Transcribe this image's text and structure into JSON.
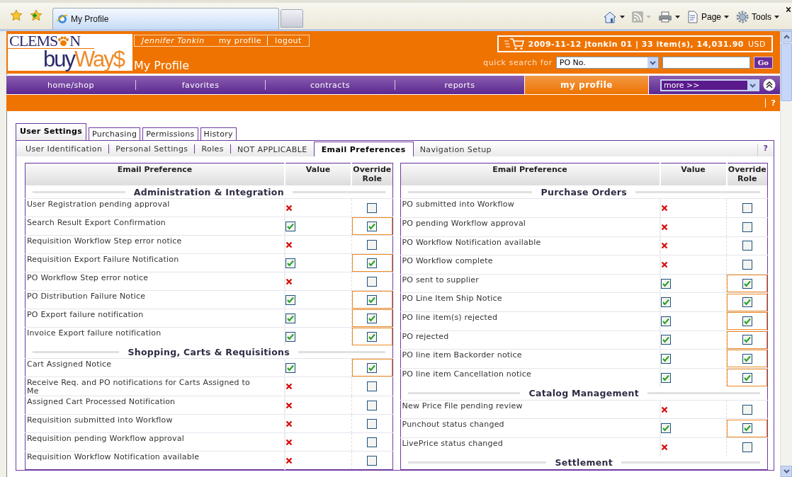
{
  "browser": {
    "tab_title": "My Profile",
    "toolbar": [
      {
        "kind": "home"
      },
      {
        "kind": "feed"
      },
      {
        "kind": "print"
      },
      {
        "kind": "page",
        "label": "Page"
      },
      {
        "kind": "tools",
        "label": "Tools"
      }
    ]
  },
  "logo": {
    "top_start": "CLEMS",
    "top_end": "N",
    "bottom_start": "buy",
    "bottom_end": "Way$"
  },
  "user_box": {
    "name": "Jennifer Tonkin",
    "links": [
      "my profile",
      "logout"
    ]
  },
  "page_title": "My Profile",
  "cart": {
    "summary": "2009-11-12 jtonkin 01 | 33 item(s), 14,031.90",
    "currency": "USD"
  },
  "quick_search": {
    "label": "quick search for",
    "type": "PO No.",
    "button": "Go"
  },
  "nav": [
    {
      "label": "home/shop",
      "selected": false
    },
    {
      "label": "favorites",
      "selected": false
    },
    {
      "label": "contracts",
      "selected": false
    },
    {
      "label": "reports",
      "selected": false
    },
    {
      "label": "my profile",
      "selected": true
    }
  ],
  "more_select": "more >>",
  "help": "?",
  "tabs": [
    {
      "label": "User Settings",
      "selected": true
    },
    {
      "label": "Purchasing",
      "selected": false
    },
    {
      "label": "Permissions",
      "selected": false
    },
    {
      "label": "History",
      "selected": false
    }
  ],
  "subtabs": [
    {
      "label": "User Identification",
      "selected": false
    },
    {
      "label": "Personal Settings",
      "selected": false
    },
    {
      "label": "Roles",
      "selected": false
    },
    {
      "label": "NOT APPLICABLE",
      "selected": false
    },
    {
      "label": "Email Preferences",
      "selected": true
    },
    {
      "label": "Navigation Setup",
      "selected": false
    }
  ],
  "subtabs_help": "?",
  "panels": [
    {
      "columns": [
        "Email Preference",
        "Value",
        "Override Role"
      ],
      "sections": [
        {
          "title": "Administration & Integration",
          "rows": [
            {
              "label": "User Registration pending approval",
              "value": false,
              "override": false
            },
            {
              "label": "Search Result Export Confirmation",
              "value": true,
              "override": true
            },
            {
              "label": "Requisition Workflow Step error notice",
              "value": false,
              "override": false
            },
            {
              "label": "Requisition Export Failure Notification",
              "value": true,
              "override": true
            },
            {
              "label": "PO Workflow Step error notice",
              "value": false,
              "override": false
            },
            {
              "label": "PO Distribution Failure Notice",
              "value": true,
              "override": true
            },
            {
              "label": "PO Export failure notification",
              "value": true,
              "override": true
            },
            {
              "label": "Invoice Export failure notification",
              "value": true,
              "override": true
            }
          ]
        },
        {
          "title": "Shopping, Carts & Requisitions",
          "rows": [
            {
              "label": "Cart Assigned Notice",
              "value": true,
              "override": true
            },
            {
              "label": "Receive Req. and PO notifications for Carts Assigned to Me",
              "value": false,
              "override": false
            },
            {
              "label": "Assigned Cart Processed Notification",
              "value": false,
              "override": false
            },
            {
              "label": "Requisition submitted into Workflow",
              "value": false,
              "override": false
            },
            {
              "label": "Requisition pending Workflow approval",
              "value": false,
              "override": false
            },
            {
              "label": "Requisition Workflow Notification available",
              "value": false,
              "override": false
            }
          ]
        }
      ]
    },
    {
      "columns": [
        "Email Preference",
        "Value",
        "Override Role"
      ],
      "sections": [
        {
          "title": "Purchase Orders",
          "rows": [
            {
              "label": "PO submitted into Workflow",
              "value": false,
              "override": false
            },
            {
              "label": "PO pending Workflow approval",
              "value": false,
              "override": false
            },
            {
              "label": "PO Workflow Notification available",
              "value": false,
              "override": false
            },
            {
              "label": "PO Workflow complete",
              "value": false,
              "override": false
            },
            {
              "label": "PO sent to supplier",
              "value": true,
              "override": true
            },
            {
              "label": "PO Line Item Ship Notice",
              "value": true,
              "override": true
            },
            {
              "label": "PO line item(s) rejected",
              "value": true,
              "override": true
            },
            {
              "label": "PO rejected",
              "value": true,
              "override": true
            },
            {
              "label": "PO line item Backorder notice",
              "value": true,
              "override": true
            },
            {
              "label": "PO line item Cancellation notice",
              "value": true,
              "override": true
            }
          ]
        },
        {
          "title": "Catalog Management",
          "rows": [
            {
              "label": "New Price File pending review",
              "value": false,
              "override": false
            },
            {
              "label": "Punchout status changed",
              "value": true,
              "override": true
            },
            {
              "label": "LivePrice status changed",
              "value": false,
              "override": false
            }
          ]
        },
        {
          "title": "Settlement"
        }
      ]
    }
  ]
}
